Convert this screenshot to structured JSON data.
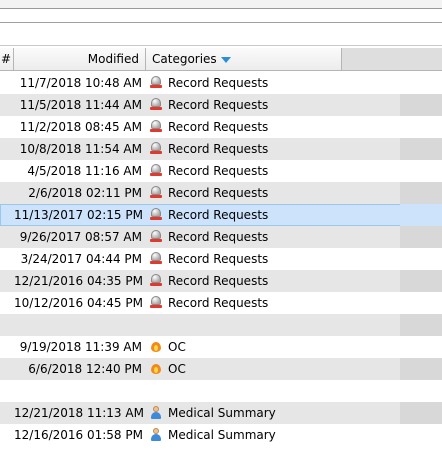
{
  "header": {
    "num": "#",
    "modified": "Modified",
    "categories": "Categories"
  },
  "rows": [
    {
      "date": "11/7/2018 10:48 AM",
      "category": "Record Requests",
      "icon": "record-icon"
    },
    {
      "date": "11/5/2018 11:44 AM",
      "category": "Record Requests",
      "icon": "record-icon"
    },
    {
      "date": "11/2/2018 08:45 AM",
      "category": "Record Requests",
      "icon": "record-icon"
    },
    {
      "date": "10/8/2018 11:54 AM",
      "category": "Record Requests",
      "icon": "record-icon"
    },
    {
      "date": "4/5/2018 11:16 AM",
      "category": "Record Requests",
      "icon": "record-icon"
    },
    {
      "date": "2/6/2018 02:11 PM",
      "category": "Record Requests",
      "icon": "record-icon"
    },
    {
      "date": "11/13/2017 02:15 PM",
      "category": "Record Requests",
      "icon": "record-icon",
      "selected": true
    },
    {
      "date": "9/26/2017 08:57 AM",
      "category": "Record Requests",
      "icon": "record-icon"
    },
    {
      "date": "3/24/2017 04:44 PM",
      "category": "Record Requests",
      "icon": "record-icon"
    },
    {
      "date": "12/21/2016 04:35 PM",
      "category": "Record Requests",
      "icon": "record-icon"
    },
    {
      "date": "10/12/2016 04:45 PM",
      "category": "Record Requests",
      "icon": "record-icon"
    },
    {
      "date": "",
      "category": "",
      "icon": ""
    },
    {
      "date": "9/19/2018 11:39 AM",
      "category": "OC",
      "icon": "flame-icon"
    },
    {
      "date": "6/6/2018 12:40 PM",
      "category": "OC",
      "icon": "flame-icon"
    },
    {
      "date": "",
      "category": "",
      "icon": ""
    },
    {
      "date": "12/21/2018 11:13 AM",
      "category": "Medical Summary",
      "icon": "person-icon"
    },
    {
      "date": "12/16/2016 01:58 PM",
      "category": "Medical Summary",
      "icon": "person-icon"
    }
  ]
}
